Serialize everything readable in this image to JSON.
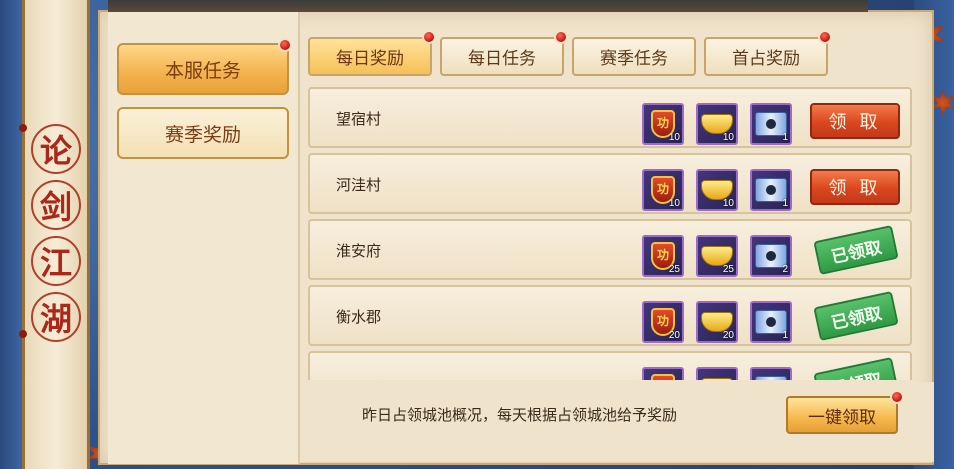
{
  "game_title": [
    "论",
    "剑",
    "江",
    "湖"
  ],
  "side_menu": [
    {
      "label": "本服任务",
      "active": true,
      "has_dot": true
    },
    {
      "label": "赛季奖励",
      "active": false,
      "has_dot": false
    }
  ],
  "tabs": [
    {
      "label": "每日奖励",
      "active": true,
      "has_dot": true
    },
    {
      "label": "每日任务",
      "active": false,
      "has_dot": false
    },
    {
      "label": "赛季任务",
      "active": false,
      "has_dot": true
    },
    {
      "label": "首占奖励",
      "active": false,
      "has_dot": true
    }
  ],
  "rows": [
    {
      "name": "望宿村",
      "rewards": [
        {
          "icon": "merit-badge-icon",
          "glyph": "功",
          "count": "10"
        },
        {
          "icon": "gold-ingot-icon",
          "count": "10"
        },
        {
          "icon": "scroll-icon",
          "count": "1"
        }
      ],
      "status": "claim",
      "action_label": "领 取"
    },
    {
      "name": "河洼村",
      "rewards": [
        {
          "icon": "merit-badge-icon",
          "glyph": "功",
          "count": "10"
        },
        {
          "icon": "gold-ingot-icon",
          "count": "10"
        },
        {
          "icon": "scroll-icon",
          "count": "1"
        }
      ],
      "status": "claim",
      "action_label": "领 取"
    },
    {
      "name": "淮安府",
      "rewards": [
        {
          "icon": "merit-badge-icon",
          "glyph": "功",
          "count": "25"
        },
        {
          "icon": "gold-ingot-icon",
          "count": "25"
        },
        {
          "icon": "scroll-icon",
          "count": "2"
        }
      ],
      "status": "claimed",
      "action_label": "已领取"
    },
    {
      "name": "衡水郡",
      "rewards": [
        {
          "icon": "merit-badge-icon",
          "glyph": "功",
          "count": "20"
        },
        {
          "icon": "gold-ingot-icon",
          "count": "20"
        },
        {
          "icon": "scroll-icon",
          "count": "1"
        }
      ],
      "status": "claimed",
      "action_label": "已领取"
    },
    {
      "name": "",
      "rewards": [
        {
          "icon": "merit-badge-icon",
          "glyph": "功",
          "count": ""
        },
        {
          "icon": "gold-ingot-icon",
          "count": ""
        },
        {
          "icon": "scroll-icon",
          "count": ""
        }
      ],
      "status": "claimed",
      "action_label": "已领取"
    }
  ],
  "footer": {
    "description": "昨日占领城池概况，每天根据占领城池给予奖励",
    "one_key_label": "一键领取",
    "one_key_has_dot": true
  },
  "colors": {
    "claim_button": "#d9471f",
    "claimed_stamp": "#2f9a45",
    "active_tab": "#f6c057",
    "notification_dot": "#c0160e"
  }
}
